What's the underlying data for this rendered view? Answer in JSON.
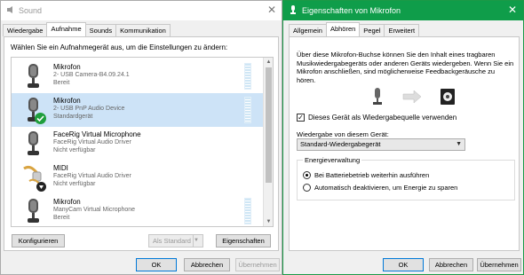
{
  "sound": {
    "title": "Sound",
    "close": "✕",
    "tabs": [
      "Wiedergabe",
      "Aufnahme",
      "Sounds",
      "Kommunikation"
    ],
    "instruction": "Wählen Sie ein Aufnahmegerät aus, um die Einstellungen zu ändern:",
    "devices": [
      {
        "name": "Mikrofon",
        "line1": "2- USB Camera-B4.09.24.1",
        "line2": "Bereit"
      },
      {
        "name": "Mikrofon",
        "line1": "2- USB PnP Audio Device",
        "line2": "Standardgerät"
      },
      {
        "name": "FaceRig Virtual Microphone",
        "line1": "FaceRig Virtual Audio Driver",
        "line2": "Nicht verfügbar"
      },
      {
        "name": "MIDI",
        "line1": "FaceRig Virtual Audio Driver",
        "line2": "Nicht verfügbar"
      },
      {
        "name": "Mikrofon",
        "line1": "ManyCam Virtual Microphone",
        "line2": "Bereit"
      }
    ],
    "buttons": {
      "configure": "Konfigurieren",
      "set_default": "Als Standard",
      "properties": "Eigenschaften",
      "ok": "OK",
      "cancel": "Abbrechen",
      "apply": "Übernehmen"
    }
  },
  "props": {
    "title": "Eigenschaften von Mikrofon",
    "close": "✕",
    "tabs": [
      "Allgemein",
      "Abhören",
      "Pegel",
      "Erweitert"
    ],
    "description": "Über diese Mikrofon-Buchse können Sie den Inhalt eines tragbaren Musikwiedergabegeräts oder anderen Geräts wiedergeben. Wenn Sie ein Mikrofon anschließen, sind möglicherweise Feedbackgeräusche zu hören.",
    "checkbox_label": "Dieses Gerät als Wiedergabequelle verwenden",
    "checkbox_checked": true,
    "playback_label": "Wiedergabe von diesem Gerät:",
    "playback_value": "Standard-Wiedergabegerät",
    "power_group_title": "Energieverwaltung",
    "radio_battery": "Bei Batteriebetrieb weiterhin ausführen",
    "radio_auto": "Automatisch deaktivieren, um Energie zu sparen",
    "buttons": {
      "ok": "OK",
      "cancel": "Abbrechen",
      "apply": "Übernehmen"
    }
  },
  "colors": {
    "accent_green": "#0f9d4a",
    "selection": "#cde3f7",
    "check_green": "#1e9e3c"
  }
}
